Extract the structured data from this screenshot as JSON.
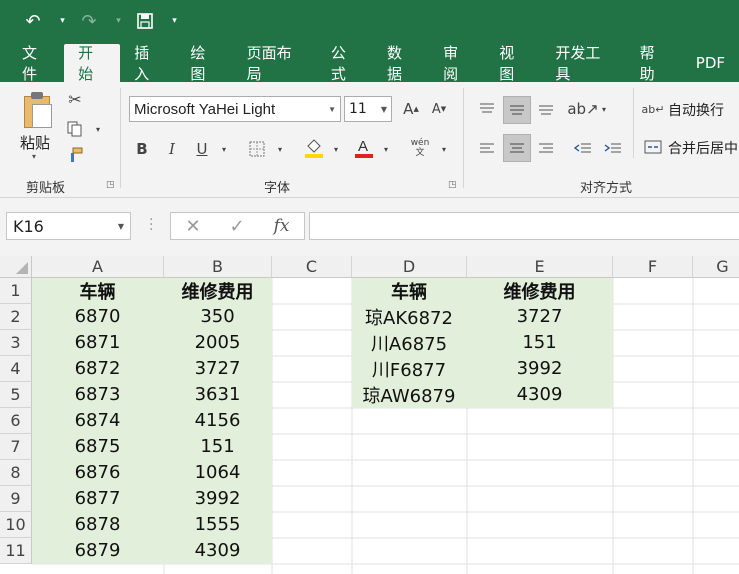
{
  "qat": {
    "undo": "↶",
    "redo": "↷",
    "save": "💾"
  },
  "tabs": [
    "文件",
    "开始",
    "插入",
    "绘图",
    "页面布局",
    "公式",
    "数据",
    "审阅",
    "视图",
    "开发工具",
    "帮助",
    "PDF"
  ],
  "ribbon": {
    "clipboard": {
      "paste_label": "粘贴",
      "group_label": "剪贴板"
    },
    "font": {
      "name": "Microsoft YaHei Light",
      "size": "11",
      "group_label": "字体",
      "bold": "B",
      "italic": "I",
      "underline": "U",
      "wen": "wén\n文",
      "grow": "A",
      "shrink": "A"
    },
    "alignment": {
      "wrap_label": "自动换行",
      "merge_label": "合并后居中",
      "group_label": "对齐方式"
    },
    "colors": {
      "fill": "#ffd800",
      "font": "#e0201b"
    }
  },
  "formula_bar": {
    "cell_ref": "K16",
    "cancel": "✕",
    "enter": "✓",
    "fx": "fx",
    "value": ""
  },
  "grid": {
    "columns": [
      "A",
      "B",
      "C",
      "D",
      "E",
      "F",
      "G"
    ],
    "rows": [
      "1",
      "2",
      "3",
      "4",
      "5",
      "6",
      "7",
      "8",
      "9",
      "10",
      "11"
    ],
    "table1": {
      "headers": [
        "车辆",
        "维修费用"
      ],
      "rows": [
        [
          "6870",
          "350"
        ],
        [
          "6871",
          "2005"
        ],
        [
          "6872",
          "3727"
        ],
        [
          "6873",
          "3631"
        ],
        [
          "6874",
          "4156"
        ],
        [
          "6875",
          "151"
        ],
        [
          "6876",
          "1064"
        ],
        [
          "6877",
          "3992"
        ],
        [
          "6878",
          "1555"
        ],
        [
          "6879",
          "4309"
        ]
      ]
    },
    "table2": {
      "headers": [
        "车辆",
        "维修费用"
      ],
      "rows": [
        [
          "琼AK6872",
          "3727"
        ],
        [
          "川A6875",
          "151"
        ],
        [
          "川F6877",
          "3992"
        ],
        [
          "琼AW6879",
          "4309"
        ]
      ]
    }
  }
}
